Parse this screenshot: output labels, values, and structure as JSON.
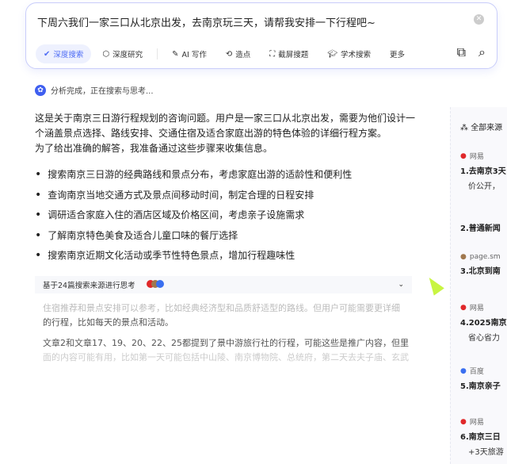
{
  "query": "下周六我们一家三口从北京出发，去南京玩三天，请帮我安排一下行程吧~",
  "tools": [
    {
      "label": "深度搜索",
      "icon": "check-circle-icon"
    },
    {
      "label": "深度研究",
      "icon": "cube-icon"
    },
    {
      "label": "AI 写作",
      "icon": "pen-icon"
    },
    {
      "label": "造点",
      "icon": "loop-icon"
    },
    {
      "label": "截屏搜题",
      "icon": "scan-icon"
    },
    {
      "label": "学术搜索",
      "icon": "graduation-icon"
    },
    {
      "label": "更多",
      "icon": ""
    }
  ],
  "status": "分析完成，正在搜索与思考...",
  "intro": [
    "这是关于南京三日游行程规划的咨询问题。用户是一家三口从北京出发，需要为他们设计一个涵盖景点选择、路线安排、交通住宿及适合家庭出游的特色体验的详细行程方案。",
    "为了给出准确的解答，我准备通过这些步骤来收集信息。"
  ],
  "bullets": [
    "搜索南京三日游的经典路线和景点分布，考虑家庭出游的适龄性和便利性",
    "查询南京当地交通方式及景点间移动时间，制定合理的日程安排",
    "调研适合家庭入住的酒店区域及价格区间，考虑亲子设施需求",
    "了解南京特色美食及适合儿童口味的餐厅选择",
    "搜索南京近期文化活动或季节性特色景点，增加行程趣味性"
  ],
  "thinking": {
    "title": "基于24篇搜索来源进行思考",
    "lines": [
      "住宿推荐和景点安排可以参考，比如经典经济型和品质舒适型的路线。但用户可能需要更详细",
      "的行程，比如每天的景点和活动。",
      "文章2和文章17、19、20、22、25都提到了景中游旅行社的行程，可能这些是推广内容，但里",
      "面的内容可能有用，比如第一天可能包括中山陵、南京博物院、总统府，第二天去夫子庙、玄武"
    ]
  },
  "sources": {
    "title": "全部来源",
    "items": [
      {
        "site": "网易",
        "title": "1.去南京3天",
        "sub": "价公开，",
        "color": "#e0282a"
      },
      {
        "site": "",
        "title": "2.普通新闻",
        "sub": "",
        "color": ""
      },
      {
        "site": "page.sm",
        "title": "3.北京到南",
        "sub": "",
        "color": "#a0784e"
      },
      {
        "site": "网易",
        "title": "4.2025南京",
        "sub": "省心省力",
        "color": "#e0282a"
      },
      {
        "site": "百度",
        "title": "5.南京亲子",
        "sub": "",
        "color": "#3a6ff0"
      },
      {
        "site": "网易",
        "title": "6.南京三日",
        "sub": "+3天旅游",
        "color": "#e0282a"
      }
    ]
  }
}
